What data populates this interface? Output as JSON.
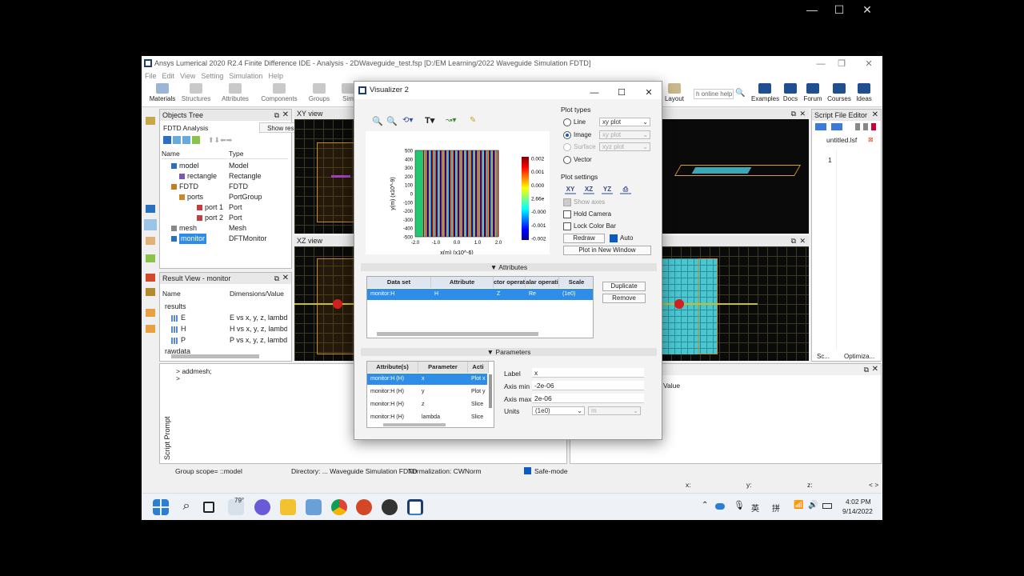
{
  "outer_window": {
    "minimize": "—",
    "maximize": "☐",
    "close": "✕"
  },
  "app": {
    "title": "Ansys Lumerical 2020 R2.4 Finite Difference IDE - Analysis - 2DWaveguide_test.fsp [D:/EM Learning/2022 Waveguide Simulation FDTD]",
    "menu": [
      "File",
      "Edit",
      "View",
      "Setting",
      "Simulation",
      "Help"
    ],
    "ribbon": [
      "Materials",
      "Structures",
      "Attributes",
      "Components",
      "Groups",
      "Sim"
    ],
    "ribbon_right": {
      "layout": "Layout",
      "search_placeholder": "h online help",
      "links": [
        "Examples",
        "Docs",
        "Forum",
        "Courses",
        "Ideas"
      ]
    },
    "colors": {
      "taskbar_bg": "#eef1f6",
      "grid": "#3a3a1e",
      "selection": "#2d8de8"
    }
  },
  "objects_tree": {
    "title": "Objects Tree",
    "analysis": "FDTD Analysis",
    "show_result": "Show result view",
    "col_name": "Name",
    "col_type": "Type",
    "items": [
      {
        "name": "model",
        "type": "Model"
      },
      {
        "name": "rectangle",
        "type": "Rectangle"
      },
      {
        "name": "FDTD",
        "type": "FDTD"
      },
      {
        "name": "ports",
        "type": "PortGroup"
      },
      {
        "name": "port 1",
        "type": "Port"
      },
      {
        "name": "port 2",
        "type": "Port"
      },
      {
        "name": "mesh",
        "type": "Mesh"
      },
      {
        "name": "monitor",
        "type": "DFTMonitor"
      }
    ]
  },
  "result_view": {
    "title": "Result View - monitor",
    "col_name": "Name",
    "col_dims": "Dimensions/Value",
    "items": [
      {
        "name": "results",
        "dims": ""
      },
      {
        "name": "E",
        "dims": "E vs x, y, z, lambd"
      },
      {
        "name": "H",
        "dims": "H vs x, y, z, lambd"
      },
      {
        "name": "P",
        "dims": "P vs x, y, z, lambd"
      },
      {
        "name": "rawdata",
        "dims": ""
      }
    ]
  },
  "views": {
    "xy": "XY view",
    "xz": "XZ view"
  },
  "script_prompt": {
    "label": "Script Prompt",
    "lines": [
      "> addmesh;",
      "> "
    ]
  },
  "script_editor": {
    "title": "Script File Editor",
    "file": "untitled.lsf",
    "line": "1",
    "tab1": "Sc...",
    "tab2": "Optimiza..."
  },
  "value_panel": {
    "value": "Value"
  },
  "statusbar": {
    "scope": "Group scope= ::model",
    "directory": "Directory: ... Waveguide Simulation FDTD",
    "normalization": "Normalization: CWNorm",
    "safe": "Safe-mode",
    "x": "x:",
    "y": "y:",
    "z": "z:",
    "nav": "< >"
  },
  "taskbar": {
    "weather": "79°",
    "lang1": "英",
    "lang2": "拼",
    "time": "4:02 PM",
    "date": "9/14/2022"
  },
  "visualizer": {
    "title": "Visualizer 2",
    "plot_types_label": "Plot types",
    "plot_types": [
      {
        "label": "Line",
        "option": "xy plot",
        "selected": false,
        "enabled": true
      },
      {
        "label": "Image",
        "option": "xy plot",
        "selected": true,
        "enabled": true
      },
      {
        "label": "Surface",
        "option": "xyz plot",
        "selected": false,
        "enabled": false
      },
      {
        "label": "Vector",
        "option": "",
        "selected": false,
        "enabled": true
      }
    ],
    "plot_settings_label": "Plot settings",
    "view_buttons": [
      "XY",
      "XZ",
      "YZ",
      "⎙"
    ],
    "show_axes": "Show axes",
    "hold_camera": "Hold Camera",
    "lock_color_bar": "Lock Color Bar",
    "redraw": "Redraw",
    "auto": "Auto",
    "plot_new_window": "Plot in New Window",
    "attributes_label": "Attributes",
    "attr_columns": [
      "Data set",
      "Attribute",
      "ctor operati",
      "alar operati",
      "Scale"
    ],
    "attr_row": [
      "monitor:H",
      "H",
      "Z",
      "Re",
      "(1e0)"
    ],
    "duplicate": "Duplicate",
    "remove": "Remove",
    "parameters_label": "Parameters",
    "param_columns": [
      "Attribute(s)",
      "Parameter",
      "Acti"
    ],
    "param_rows": [
      [
        "monitor:H (H)",
        "x",
        "Plot x"
      ],
      [
        "monitor:H (H)",
        "y",
        "Plot y"
      ],
      [
        "monitor:H (H)",
        "z",
        "Slice"
      ],
      [
        "monitor:H (H)",
        "lambda",
        "Slice"
      ]
    ],
    "label_lbl": "Label",
    "label_val": "x",
    "axis_min_lbl": "Axis min",
    "axis_min_val": "-2e-06",
    "axis_max_lbl": "Axis max",
    "axis_max_val": "2e-06",
    "units_lbl": "Units",
    "units_val": "(1e0)",
    "units_unit": "m"
  },
  "chart_data": {
    "type": "heatmap",
    "xlabel": "x(m) (x10^-6)",
    "ylabel": "y(m) (x10^-9)",
    "xticks": [
      "-2.0",
      "-1.0",
      "0.0",
      "1.0",
      "2.0"
    ],
    "yticks": [
      "500",
      "400",
      "300",
      "200",
      "100",
      "0",
      "-100",
      "-200",
      "-300",
      "-400",
      "-500"
    ],
    "xlim": [
      -2,
      2
    ],
    "ylim": [
      -500,
      500
    ],
    "colorbar_ticks": [
      "0.002",
      "0.001",
      "0.000",
      "2.66e",
      "-0.000",
      "-0.001",
      "-0.002"
    ],
    "stripe_count": 17,
    "colormap": [
      "#00008f",
      "#0000ff",
      "#0080ff",
      "#00ffff",
      "#80ff80",
      "#ffff00",
      "#ff8000",
      "#ff0000",
      "#800000"
    ],
    "source_band_color": "#22c870"
  }
}
